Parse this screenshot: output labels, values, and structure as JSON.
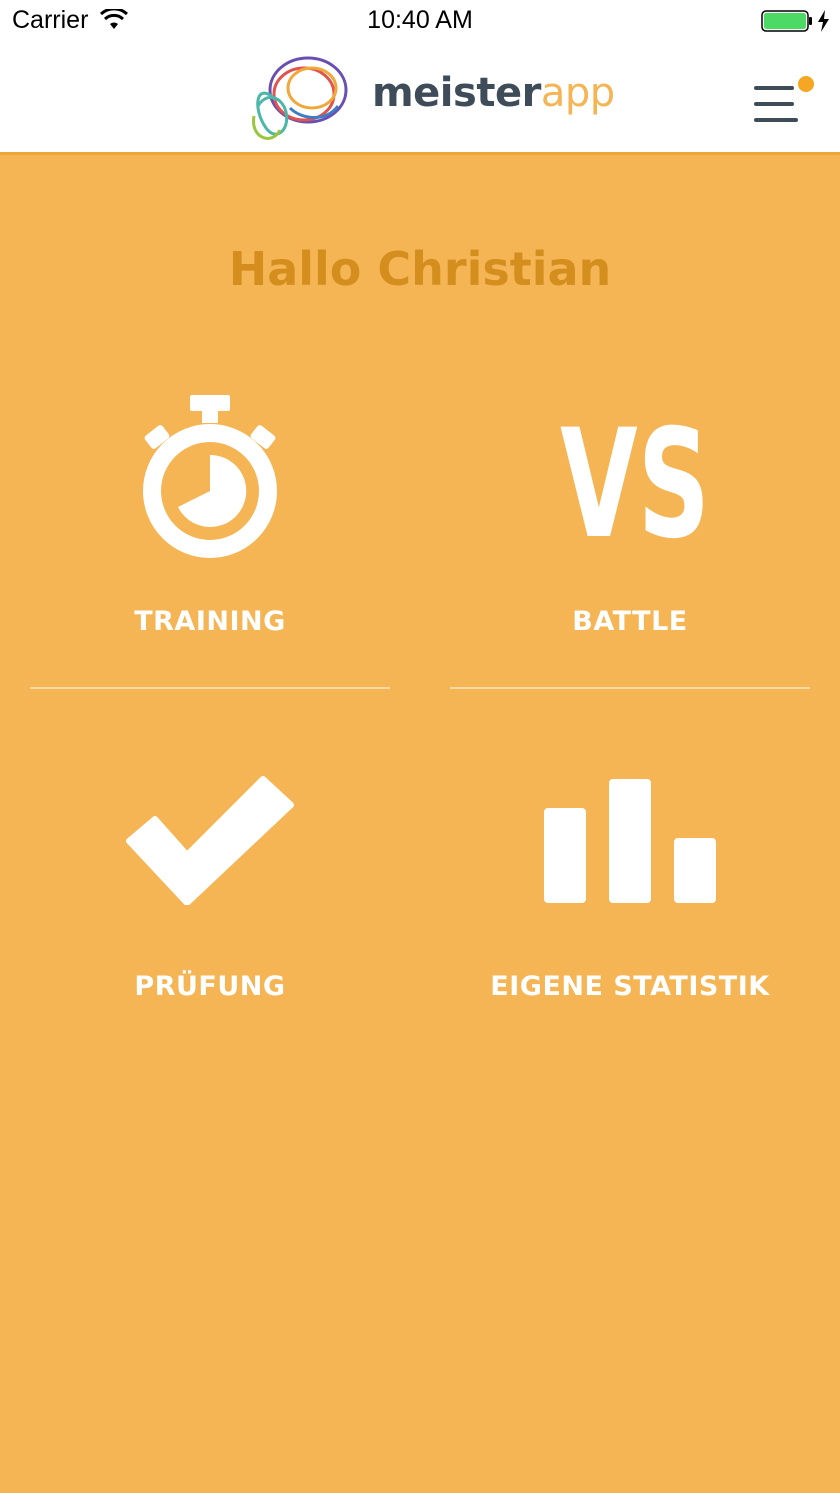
{
  "status_bar": {
    "carrier": "Carrier",
    "time": "10:40 AM"
  },
  "header": {
    "brand_dark": "meister",
    "brand_accent": "app",
    "notification_color": "#F5A623"
  },
  "greeting": "Hallo Christian",
  "tiles": [
    {
      "label": "TRAINING",
      "icon": "stopwatch-icon"
    },
    {
      "label": "BATTLE",
      "icon": "vs-icon"
    },
    {
      "label": "PRÜFUNG",
      "icon": "checkmark-icon"
    },
    {
      "label": "EIGENE STATISTIK",
      "icon": "bar-chart-icon"
    }
  ],
  "vs_text": "VS",
  "colors": {
    "background": "#F5B555",
    "greeting": "#D48E1E",
    "header_text": "#3E4C59",
    "icon": "#ffffff"
  }
}
